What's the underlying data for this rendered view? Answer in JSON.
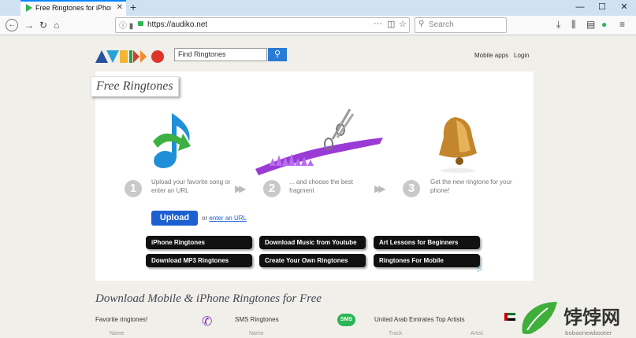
{
  "browser": {
    "tab_title": "Free Ringtones for iPhone and",
    "tab_close": "✕",
    "new_tab": "+",
    "window_controls": [
      "—",
      "☐",
      "✕"
    ],
    "url": "https://audiko.net",
    "search_placeholder": "Search"
  },
  "site": {
    "logo_text": "AVDIKO",
    "search_placeholder": "Find Ringtones",
    "search_icon": "magnifier",
    "nav": {
      "mobile_apps": "Mobile apps",
      "login": "Login"
    }
  },
  "hero": {
    "badge": "Free Ringtones",
    "steps": [
      {
        "num": "1",
        "text": "Upload your favorite song or enter an URL"
      },
      {
        "num": "2",
        "text": "... and choose the best fragment"
      },
      {
        "num": "3",
        "text": "Get the new ringtone for your phone!"
      }
    ],
    "upload_label": "Upload",
    "or_text": "or",
    "enter_url_link": "enter an URL",
    "pills": [
      "iPhone Ringtones",
      "Download Music from Youtube",
      "Art Lessons for Beginners",
      "Download MP3 Ringtones",
      "Create Your Own Ringtones",
      "Ringtones For Mobile"
    ]
  },
  "section": {
    "title": "Download Mobile & iPhone Ringtones for Free",
    "columns": [
      {
        "title": "Favorite ringtones!",
        "sub": "Name"
      },
      {
        "title": "SMS Ringtones",
        "sub": "Name"
      },
      {
        "title": "United Arab Emirates Top Artists",
        "sub": "Track"
      },
      {
        "title": "",
        "sub": "Artist"
      }
    ]
  },
  "watermark": {
    "text": "饽饽网",
    "sub": "bobaonewbooter"
  },
  "colors": {
    "accent": "#1c5fd1",
    "tab_accent": "#0a84ff",
    "purple": "#9a3bd6",
    "green": "#2db553"
  }
}
